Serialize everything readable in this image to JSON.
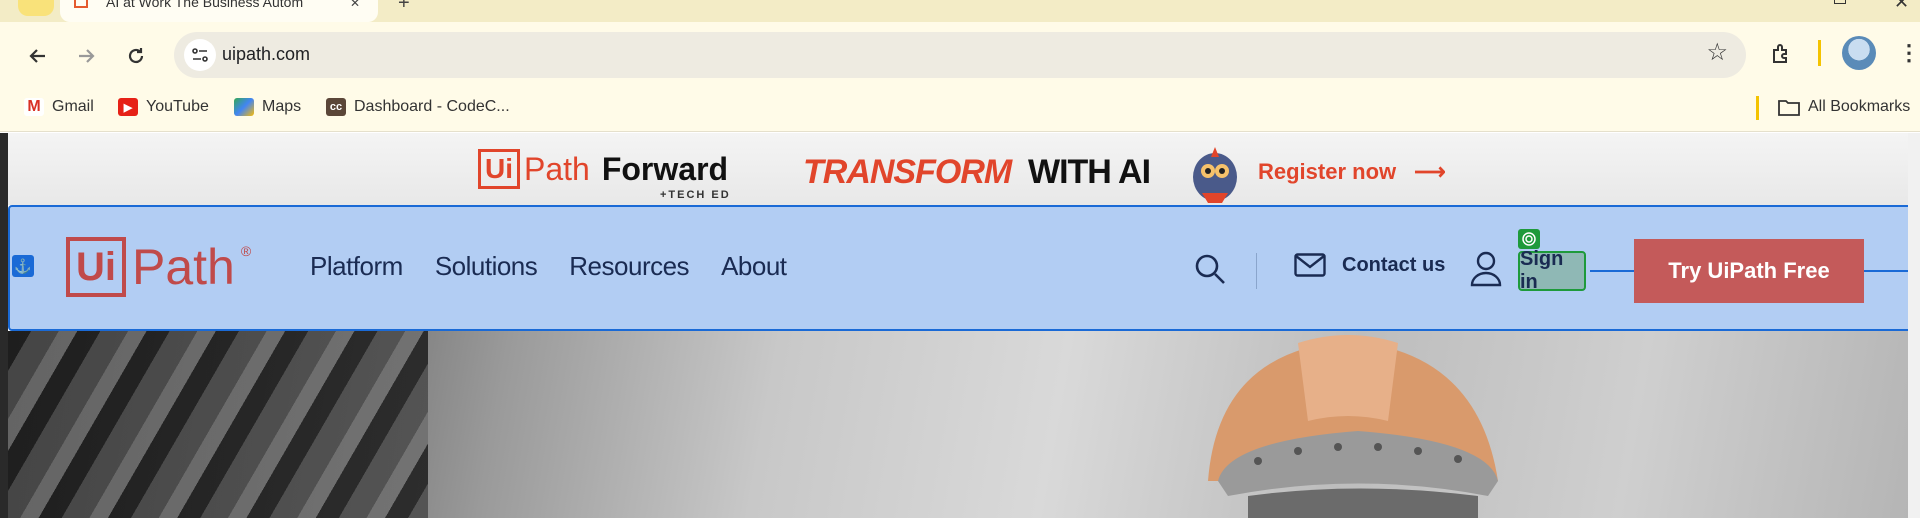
{
  "browser": {
    "tab_title": "AI at Work The Business Autom",
    "url": "uipath.com",
    "bookmarks": [
      {
        "label": "Gmail",
        "icon": "gmail-icon"
      },
      {
        "label": "YouTube",
        "icon": "youtube-icon"
      },
      {
        "label": "Maps",
        "icon": "maps-icon"
      },
      {
        "label": "Dashboard - CodeC...",
        "icon": "codechef-icon"
      }
    ],
    "all_bookmarks": "All Bookmarks",
    "new_tab": "+",
    "close": "✕"
  },
  "promo": {
    "logo_ui": "Ui",
    "logo_path": "Path",
    "logo_forward": "Forward",
    "tech_ed": "+TECH ED",
    "transform": "TRANSFORM",
    "with_ai": "WITH AI",
    "register": "Register now",
    "arrow": "⟶"
  },
  "nav": {
    "brand_ui": "Ui",
    "brand_path": "Path",
    "brand_reg": "®",
    "links": [
      "Platform",
      "Solutions",
      "Resources",
      "About"
    ],
    "contact": "Contact us",
    "sign_in": "Sign in",
    "try_button": "Try UiPath Free"
  },
  "colors": {
    "brand": "#e1452b",
    "nav_highlight": "#b2cdf3",
    "annotation_blue": "#1a6ad6",
    "annotation_green": "#1e9a3b"
  }
}
